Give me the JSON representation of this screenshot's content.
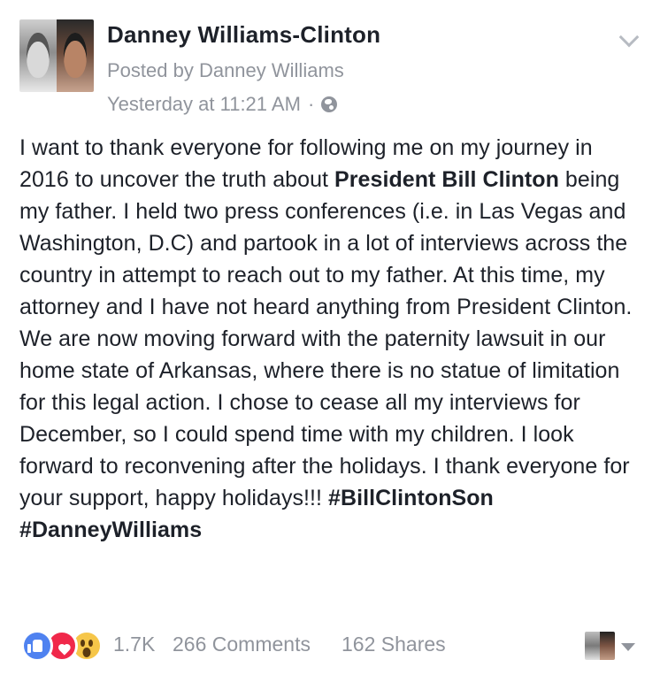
{
  "post": {
    "author": "Danney Williams-Clinton",
    "posted_by": "Posted by Danney Williams",
    "timestamp": "Yesterday at 11:21 AM",
    "separator": "·",
    "privacy_icon": "globe-icon",
    "body": {
      "p1": "I want to thank everyone for following me on my journey in 2016 to uncover the truth about ",
      "bold1": "President Bill Clinton",
      "p2": " being my father. I held two press conferences (i.e. in Las Vegas and Washington, D.C) and partook in a lot of interviews across the country in attempt to reach out to my father. At this time, my attorney and I have not heard anything from President Clinton. We are now moving forward with the paternity lawsuit in our home state of Arkansas, where there is no statue of limitation for this legal action. I chose to cease all my interviews for December, so I could spend time with my children. I look forward to reconvening after the holidays. I thank everyone for your support, happy holidays!!! ",
      "hashtag1": "#BillClintonSon",
      "hashtag2": "#DanneyWilliams"
    }
  },
  "footer": {
    "reactions": [
      "like-icon",
      "love-icon",
      "wow-icon"
    ],
    "reaction_count": "1.7K",
    "comments": "266 Comments",
    "shares": "162 Shares"
  },
  "colors": {
    "text": "#1d2129",
    "secondary": "#90949c",
    "like": "#4f82f0",
    "love": "#f0284a",
    "wow": "#f6c649"
  }
}
